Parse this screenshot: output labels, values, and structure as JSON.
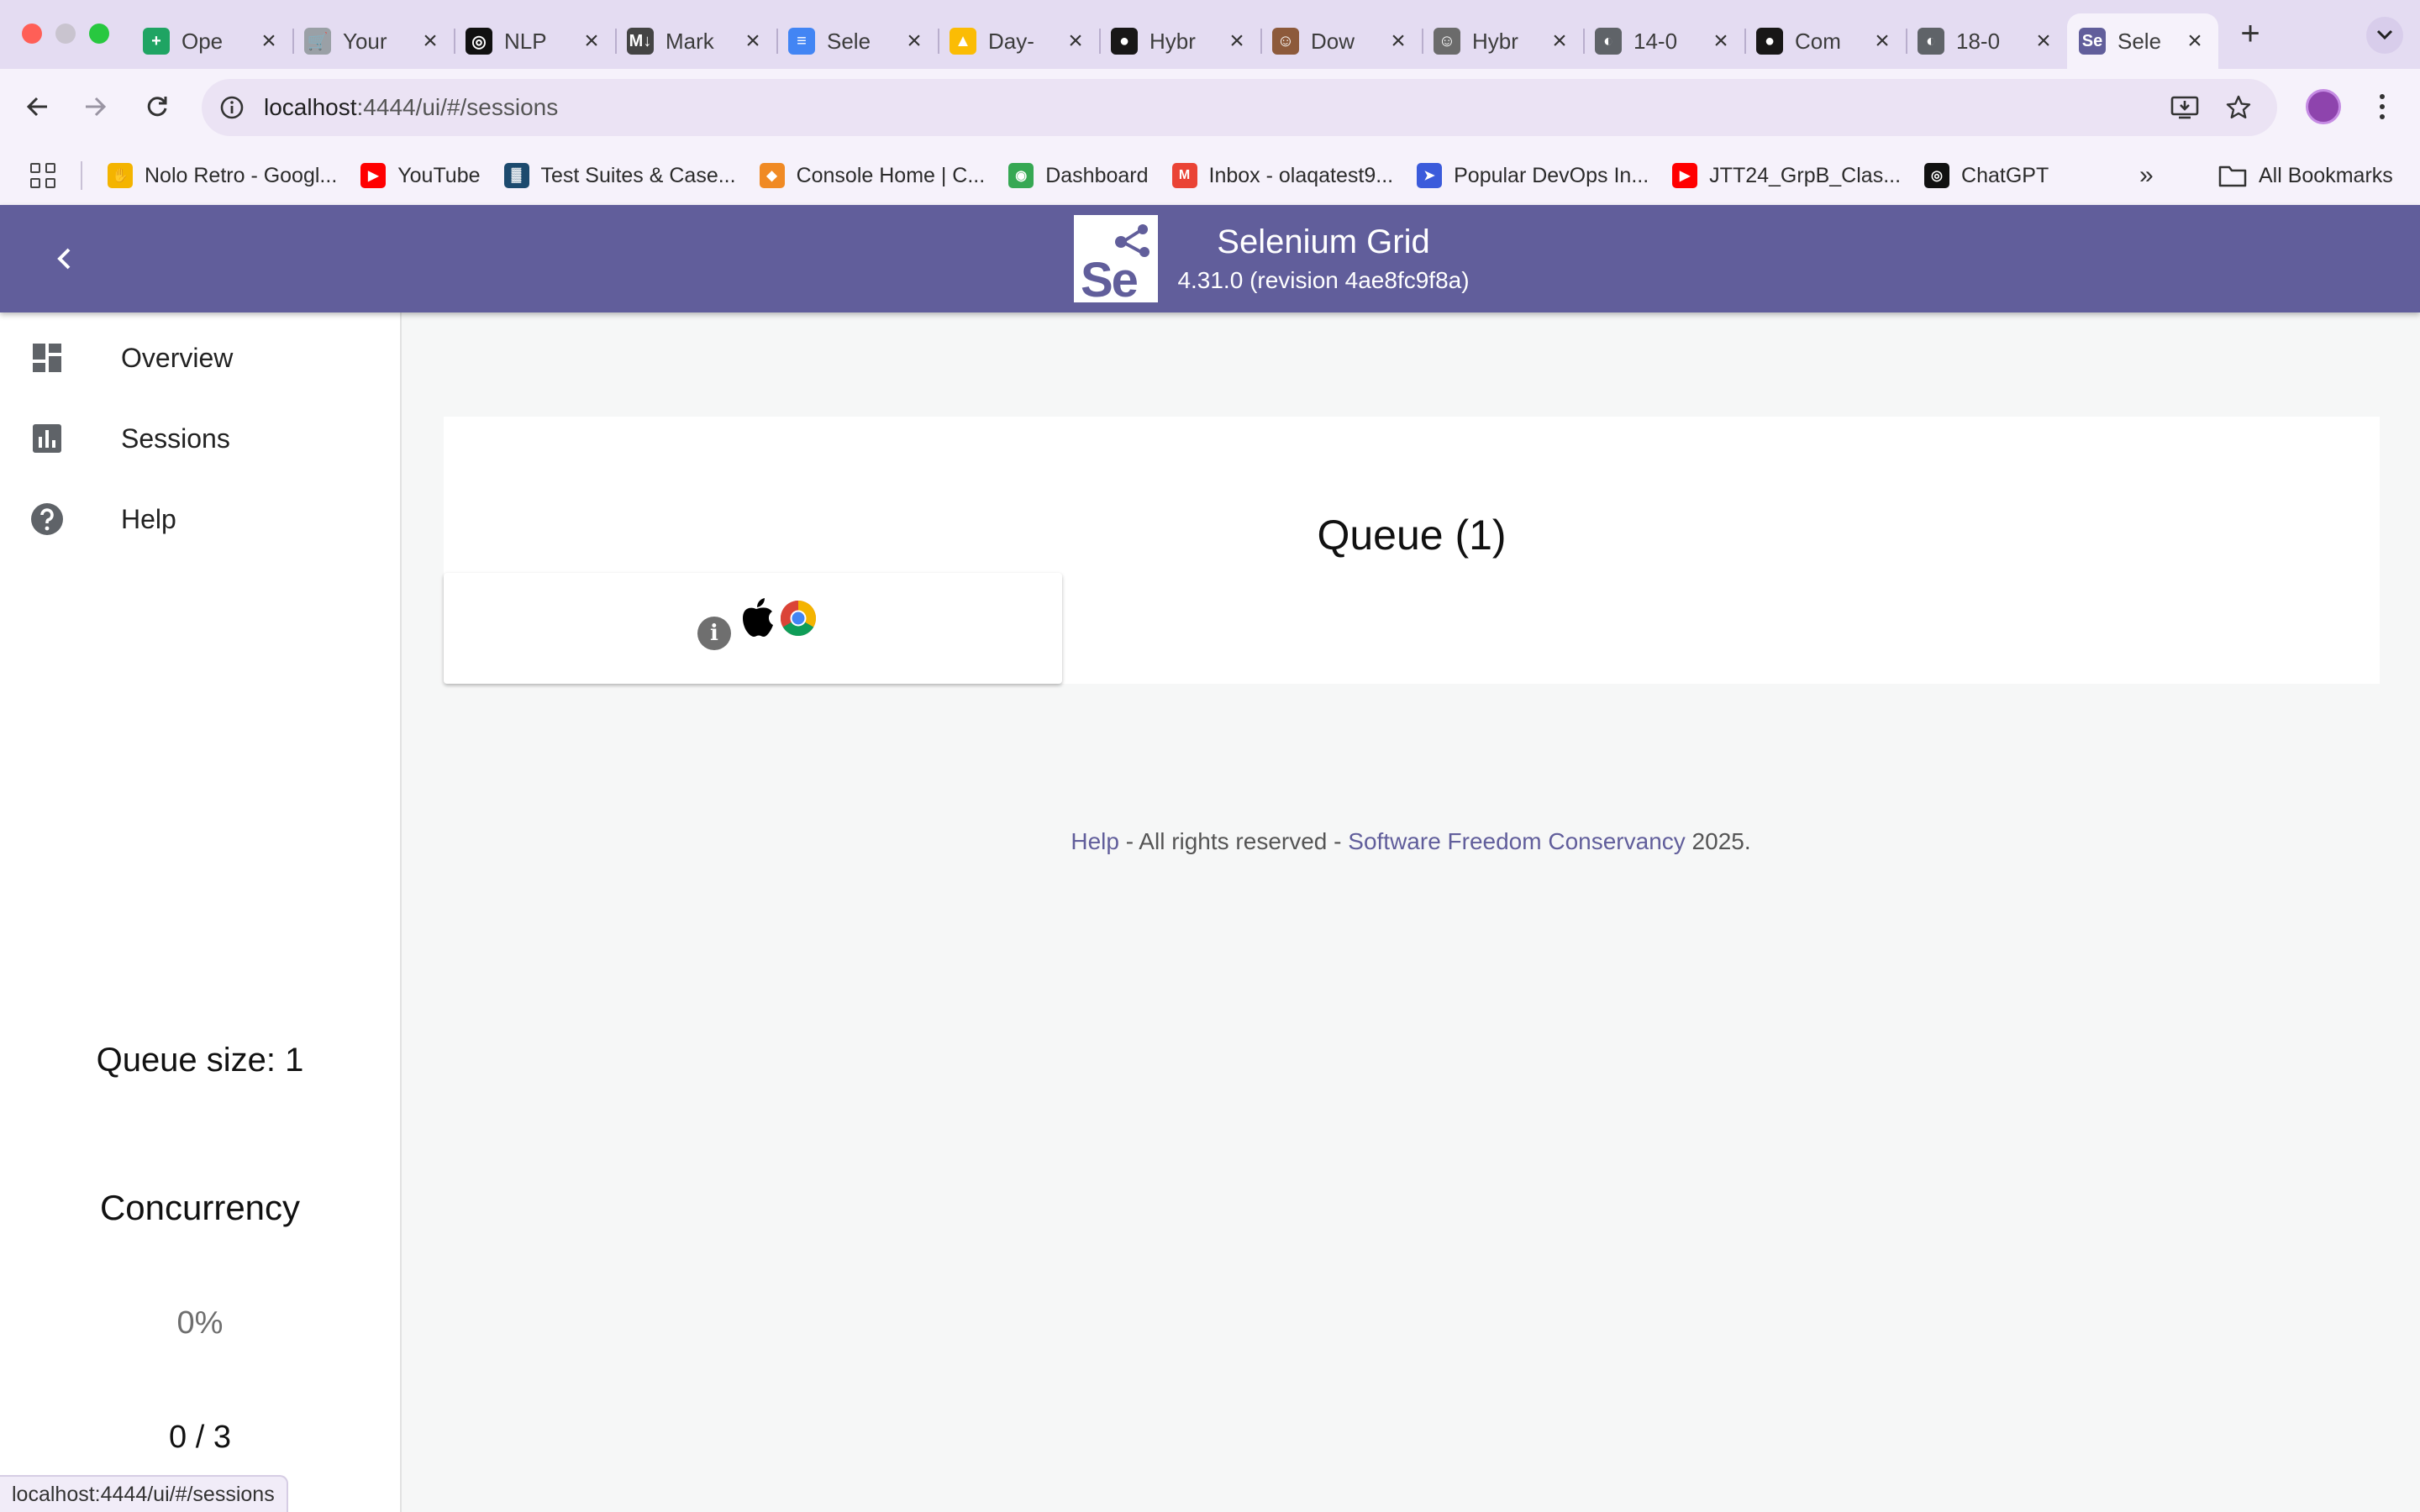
{
  "browser": {
    "tabs": [
      {
        "title": "Ope",
        "icon": "sheets-icon",
        "color": "#1fa463",
        "glyph": "+",
        "active": false
      },
      {
        "title": "Your",
        "icon": "cart-icon",
        "color": "#9aa0a6",
        "glyph": "🛒",
        "active": false
      },
      {
        "title": "NLP",
        "icon": "openai-icon",
        "color": "#111111",
        "glyph": "◎",
        "active": false
      },
      {
        "title": "Mark",
        "icon": "markdown-icon",
        "color": "#444444",
        "glyph": "M↓",
        "active": false
      },
      {
        "title": "Sele",
        "icon": "docs-icon",
        "color": "#4285f4",
        "glyph": "≡",
        "active": false
      },
      {
        "title": "Day-",
        "icon": "drive-icon",
        "color": "#fbbc04",
        "glyph": "▲",
        "active": false
      },
      {
        "title": "Hybr",
        "icon": "github-icon",
        "color": "#181717",
        "glyph": "●",
        "active": false
      },
      {
        "title": "Dow",
        "icon": "avatar-icon",
        "color": "#8d5a3b",
        "glyph": "☺",
        "active": false
      },
      {
        "title": "Hybr",
        "icon": "avatar-icon",
        "color": "#6b6b6b",
        "glyph": "☺",
        "active": false
      },
      {
        "title": "14-0",
        "icon": "globe-icon",
        "color": "#5f6368",
        "glyph": "◐",
        "active": false
      },
      {
        "title": "Com",
        "icon": "github-icon",
        "color": "#181717",
        "glyph": "●",
        "active": false
      },
      {
        "title": "18-0",
        "icon": "globe-icon",
        "color": "#5f6368",
        "glyph": "◐",
        "active": false
      },
      {
        "title": "Sele",
        "icon": "selenium-icon",
        "color": "#615e9b",
        "glyph": "Se",
        "active": true
      }
    ],
    "url": {
      "host": "localhost",
      "path": ":4444/ui/#/sessions"
    },
    "bookmarks": [
      {
        "label": "Nolo Retro - Googl...",
        "icon": "hand-icon",
        "color": "#f4b400",
        "glyph": "✋"
      },
      {
        "label": "YouTube",
        "icon": "youtube-icon",
        "color": "#ff0000",
        "glyph": "▶"
      },
      {
        "label": "Test Suites & Case...",
        "icon": "testrail-icon",
        "color": "#1c4a6e",
        "glyph": "▓"
      },
      {
        "label": "Console Home | C...",
        "icon": "aws-cube-icon",
        "color": "#f08a24",
        "glyph": "◆"
      },
      {
        "label": "Dashboard",
        "icon": "dashboard-icon",
        "color": "#36a853",
        "glyph": "◉"
      },
      {
        "label": "Inbox - olaqatest9...",
        "icon": "gmail-icon",
        "color": "#ea4335",
        "glyph": "M"
      },
      {
        "label": "Popular DevOps In...",
        "icon": "arrow-logo-icon",
        "color": "#3b5bdb",
        "glyph": "➤"
      },
      {
        "label": "JTT24_GrpB_Clas...",
        "icon": "youtube-icon",
        "color": "#ff0000",
        "glyph": "▶"
      },
      {
        "label": "ChatGPT",
        "icon": "openai-icon",
        "color": "#111111",
        "glyph": "◎"
      }
    ],
    "more_label": "»",
    "all_bookmarks_label": "All Bookmarks",
    "status_url": "localhost:4444/ui/#/sessions"
  },
  "app": {
    "title": "Selenium Grid",
    "version": "4.31.0 (revision 4ae8fc9f8a)",
    "logo_text": "Se",
    "brand_color": "#615e9b"
  },
  "sidebar": {
    "items": [
      {
        "label": "Overview",
        "icon": "dashboard-icon"
      },
      {
        "label": "Sessions",
        "icon": "bar-chart-icon"
      },
      {
        "label": "Help",
        "icon": "help-icon"
      }
    ],
    "queue_size": "Queue size: 1",
    "concurrency_title": "Concurrency",
    "concurrency_percent": "0%",
    "concurrency_ratio": "0 / 3"
  },
  "main": {
    "queue_title": "Queue (1)",
    "request_icons": [
      "info-icon",
      "apple-icon",
      "chrome-icon"
    ],
    "info_glyph": "i"
  },
  "footer": {
    "help_link": "Help",
    "middle_text": " - All rights reserved - ",
    "org_link": "Software Freedom Conservancy",
    "year_text": " 2025."
  }
}
